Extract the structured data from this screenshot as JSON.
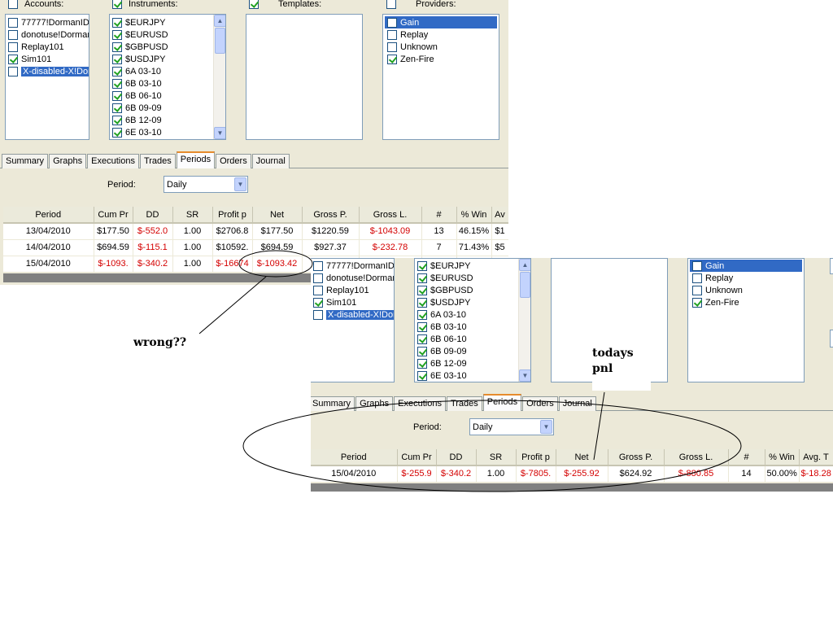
{
  "accounts_label": "Accounts:",
  "instruments_label": "Instruments:",
  "templates_label": "Templates:",
  "providers_label": "Providers:",
  "accounts": [
    {
      "label": "77777!DormanID",
      "checked": false
    },
    {
      "label": "donotuse!Dorman",
      "checked": false
    },
    {
      "label": "Replay101",
      "checked": false
    },
    {
      "label": "Sim101",
      "checked": true
    },
    {
      "label": "X-disabled-X!Dorm",
      "checked": false,
      "selected": true
    }
  ],
  "instruments": [
    {
      "label": "$EURJPY",
      "checked": true
    },
    {
      "label": "$EURUSD",
      "checked": true
    },
    {
      "label": "$GBPUSD",
      "checked": true
    },
    {
      "label": "$USDJPY",
      "checked": true
    },
    {
      "label": "6A 03-10",
      "checked": true
    },
    {
      "label": "6B 03-10",
      "checked": true
    },
    {
      "label": "6B 06-10",
      "checked": true
    },
    {
      "label": "6B 09-09",
      "checked": true
    },
    {
      "label": "6B 12-09",
      "checked": true
    },
    {
      "label": "6E 03-10",
      "checked": true
    }
  ],
  "providers": [
    {
      "label": "Gain",
      "checked": false,
      "selected": true
    },
    {
      "label": "Replay",
      "checked": false
    },
    {
      "label": "Unknown",
      "checked": false
    },
    {
      "label": "Zen-Fire",
      "checked": true
    }
  ],
  "tabs": [
    "Summary",
    "Graphs",
    "Executions",
    "Trades",
    "Periods",
    "Orders",
    "Journal"
  ],
  "active_tab": "Periods",
  "period_label": "Period:",
  "period_value": "Daily",
  "table1": {
    "headers": [
      "Period",
      "Cum Pr",
      "DD",
      "SR",
      "Profit p",
      "Net",
      "Gross P.",
      "Gross L.",
      "#",
      "% Win",
      "Av"
    ],
    "rows": [
      [
        "13/04/2010",
        "$177.50",
        "$-552.0",
        "1.00",
        "$2706.8",
        "$177.50",
        "$1220.59",
        "$-1043.09",
        "13",
        "46.15%",
        "$1"
      ],
      [
        "14/04/2010",
        "$694.59",
        "$-115.1",
        "1.00",
        "$10592.",
        "$694.59",
        "$927.37",
        "$-232.78",
        "7",
        "71.43%",
        "$5"
      ],
      [
        "15/04/2010",
        "$-1093.",
        "$-340.2",
        "1.00",
        "$-16674",
        "$-1093.42",
        "",
        "",
        "",
        "",
        ""
      ]
    ]
  },
  "table2": {
    "headers": [
      "Period",
      "Cum Pr",
      "DD",
      "SR",
      "Profit p",
      "Net",
      "Gross P.",
      "Gross L.",
      "#",
      "% Win",
      "Avg. T"
    ],
    "rows": [
      [
        "15/04/2010",
        "$-255.9",
        "$-340.2",
        "1.00",
        "$-7805.",
        "$-255.92",
        "$624.92",
        "$-880.85",
        "14",
        "50.00%",
        "$-18.28"
      ]
    ]
  },
  "annotations": {
    "wrong": "wrong??",
    "todays_line1": "todays",
    "todays_line2": "pnl"
  }
}
